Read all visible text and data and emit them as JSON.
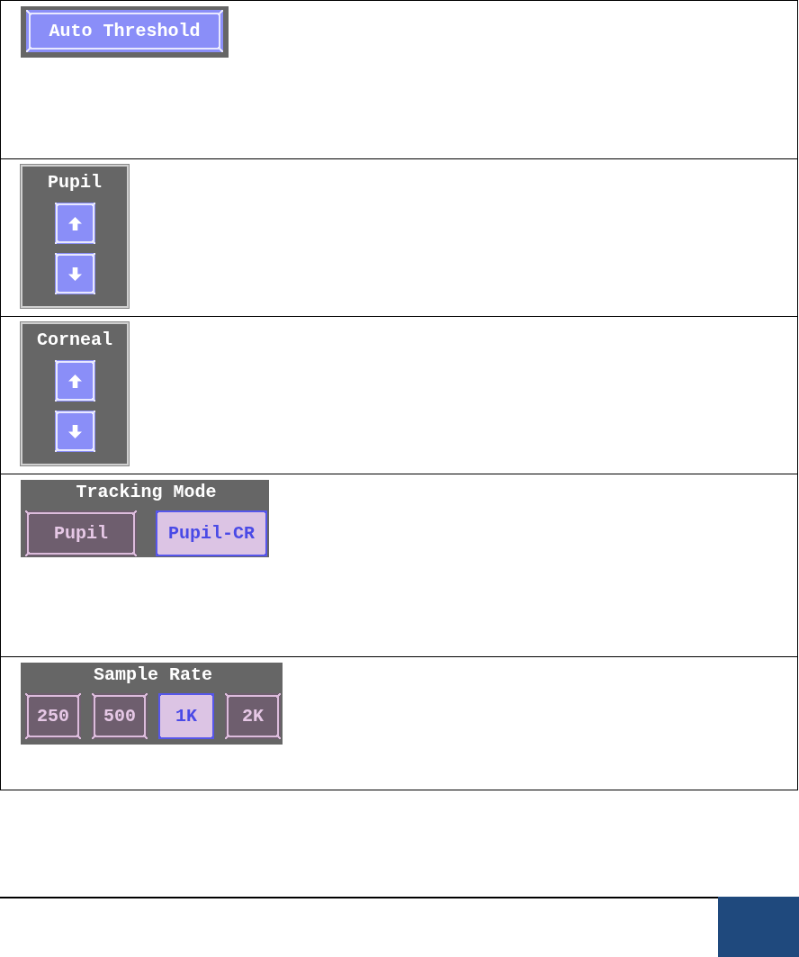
{
  "sections": [
    {
      "kind": "action",
      "label": "Auto Threshold"
    },
    {
      "kind": "stepper",
      "label": "Pupil"
    },
    {
      "kind": "stepper",
      "label": "Corneal"
    },
    {
      "kind": "choice",
      "label": "Tracking Mode",
      "options": [
        {
          "label": "Pupil",
          "selected": false
        },
        {
          "label": "Pupil-CR",
          "selected": true
        }
      ]
    },
    {
      "kind": "choice",
      "label": "Sample Rate",
      "options": [
        {
          "label": "250",
          "selected": false
        },
        {
          "label": "500",
          "selected": false
        },
        {
          "label": "1K",
          "selected": true
        },
        {
          "label": "2K",
          "selected": false
        }
      ]
    }
  ]
}
